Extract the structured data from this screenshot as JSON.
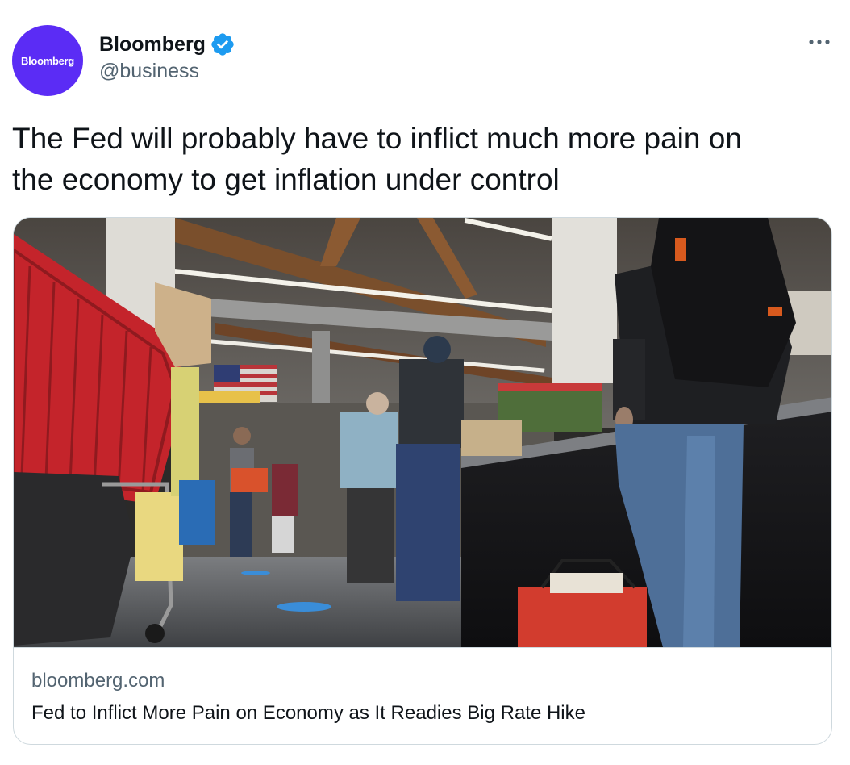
{
  "author": {
    "avatar_text": "Bloomberg",
    "display_name": "Bloomberg",
    "handle": "@business",
    "verified_icon": "verified-badge-icon",
    "avatar_color": "#5b2cf5"
  },
  "tweet": {
    "text": "The Fed will probably have to inflict much more pain on\nthe economy to get inflation under control"
  },
  "menu": {
    "icon": "more-horizontal-icon"
  },
  "card": {
    "domain": "bloomberg.com",
    "title": "Fed to Inflict More Pain on Economy as It Readies Big Rate Hike",
    "image_subject": "shoppers-in-checkout-line-photo"
  },
  "colors": {
    "text_primary": "#0f1419",
    "text_secondary": "#536471",
    "verified_blue": "#1d9bf0",
    "border": "#cfd9de"
  }
}
